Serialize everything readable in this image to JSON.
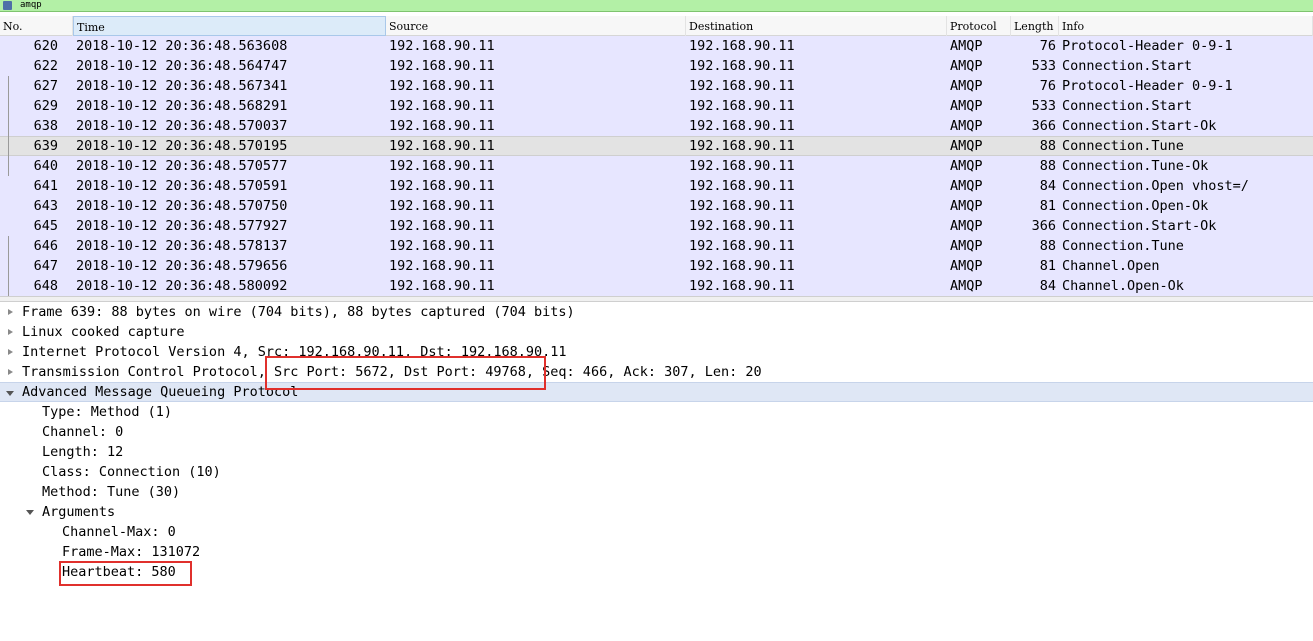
{
  "filter": {
    "text": "amqp"
  },
  "columns": [
    "No.",
    "Time",
    "Source",
    "Destination",
    "Protocol",
    "Length",
    "Info"
  ],
  "packets": [
    {
      "no": "620",
      "time": "2018-10-12 20:36:48.563608",
      "src": "192.168.90.11",
      "dst": "192.168.90.11",
      "proto": "AMQP",
      "len": "76",
      "info": "Protocol-Header 0-9-1"
    },
    {
      "no": "622",
      "time": "2018-10-12 20:36:48.564747",
      "src": "192.168.90.11",
      "dst": "192.168.90.11",
      "proto": "AMQP",
      "len": "533",
      "info": "Connection.Start"
    },
    {
      "no": "627",
      "time": "2018-10-12 20:36:48.567341",
      "src": "192.168.90.11",
      "dst": "192.168.90.11",
      "proto": "AMQP",
      "len": "76",
      "info": "Protocol-Header 0-9-1"
    },
    {
      "no": "629",
      "time": "2018-10-12 20:36:48.568291",
      "src": "192.168.90.11",
      "dst": "192.168.90.11",
      "proto": "AMQP",
      "len": "533",
      "info": "Connection.Start"
    },
    {
      "no": "638",
      "time": "2018-10-12 20:36:48.570037",
      "src": "192.168.90.11",
      "dst": "192.168.90.11",
      "proto": "AMQP",
      "len": "366",
      "info": "Connection.Start-Ok"
    },
    {
      "no": "639",
      "time": "2018-10-12 20:36:48.570195",
      "src": "192.168.90.11",
      "dst": "192.168.90.11",
      "proto": "AMQP",
      "len": "88",
      "info": "Connection.Tune"
    },
    {
      "no": "640",
      "time": "2018-10-12 20:36:48.570577",
      "src": "192.168.90.11",
      "dst": "192.168.90.11",
      "proto": "AMQP",
      "len": "88",
      "info": "Connection.Tune-Ok"
    },
    {
      "no": "641",
      "time": "2018-10-12 20:36:48.570591",
      "src": "192.168.90.11",
      "dst": "192.168.90.11",
      "proto": "AMQP",
      "len": "84",
      "info": "Connection.Open vhost=/"
    },
    {
      "no": "643",
      "time": "2018-10-12 20:36:48.570750",
      "src": "192.168.90.11",
      "dst": "192.168.90.11",
      "proto": "AMQP",
      "len": "81",
      "info": "Connection.Open-Ok"
    },
    {
      "no": "645",
      "time": "2018-10-12 20:36:48.577927",
      "src": "192.168.90.11",
      "dst": "192.168.90.11",
      "proto": "AMQP",
      "len": "366",
      "info": "Connection.Start-Ok"
    },
    {
      "no": "646",
      "time": "2018-10-12 20:36:48.578137",
      "src": "192.168.90.11",
      "dst": "192.168.90.11",
      "proto": "AMQP",
      "len": "88",
      "info": "Connection.Tune"
    },
    {
      "no": "647",
      "time": "2018-10-12 20:36:48.579656",
      "src": "192.168.90.11",
      "dst": "192.168.90.11",
      "proto": "AMQP",
      "len": "81",
      "info": "Channel.Open"
    },
    {
      "no": "648",
      "time": "2018-10-12 20:36:48.580092",
      "src": "192.168.90.11",
      "dst": "192.168.90.11",
      "proto": "AMQP",
      "len": "84",
      "info": "Channel.Open-Ok"
    }
  ],
  "selected_packet_index": 5,
  "details": [
    {
      "text": "Frame 639: 88 bytes on wire (704 bits), 88 bytes captured (704 bits)",
      "indent": 0,
      "expander": "collapsed"
    },
    {
      "text": "Linux cooked capture",
      "indent": 0,
      "expander": "collapsed"
    },
    {
      "text": "Internet Protocol Version 4, Src: 192.168.90.11, Dst: 192.168.90.11",
      "indent": 0,
      "expander": "collapsed"
    },
    {
      "text": "Transmission Control Protocol, Src Port: 5672, Dst Port: 49768, Seq: 466, Ack: 307, Len: 20",
      "indent": 0,
      "expander": "collapsed"
    },
    {
      "text": "Advanced Message Queueing Protocol",
      "indent": 0,
      "expander": "expanded",
      "selected": true
    },
    {
      "text": "Type: Method (1)",
      "indent": 1,
      "expander": "none"
    },
    {
      "text": "Channel: 0",
      "indent": 1,
      "expander": "none"
    },
    {
      "text": "Length: 12",
      "indent": 1,
      "expander": "none"
    },
    {
      "text": "Class: Connection (10)",
      "indent": 1,
      "expander": "none"
    },
    {
      "text": "Method: Tune (30)",
      "indent": 1,
      "expander": "none"
    },
    {
      "text": "Arguments",
      "indent": 1,
      "expander": "expanded"
    },
    {
      "text": "Channel-Max: 0",
      "indent": 2,
      "expander": "none"
    },
    {
      "text": "Frame-Max: 131072",
      "indent": 2,
      "expander": "none"
    },
    {
      "text": "Heartbeat: 580",
      "indent": 2,
      "expander": "none"
    }
  ],
  "colors": {
    "row_bg": "#e7e6ff",
    "selected_row_bg": "#e3e3e3",
    "filter_bg": "#b3f0a6",
    "highlight_box": "#e0302c"
  }
}
